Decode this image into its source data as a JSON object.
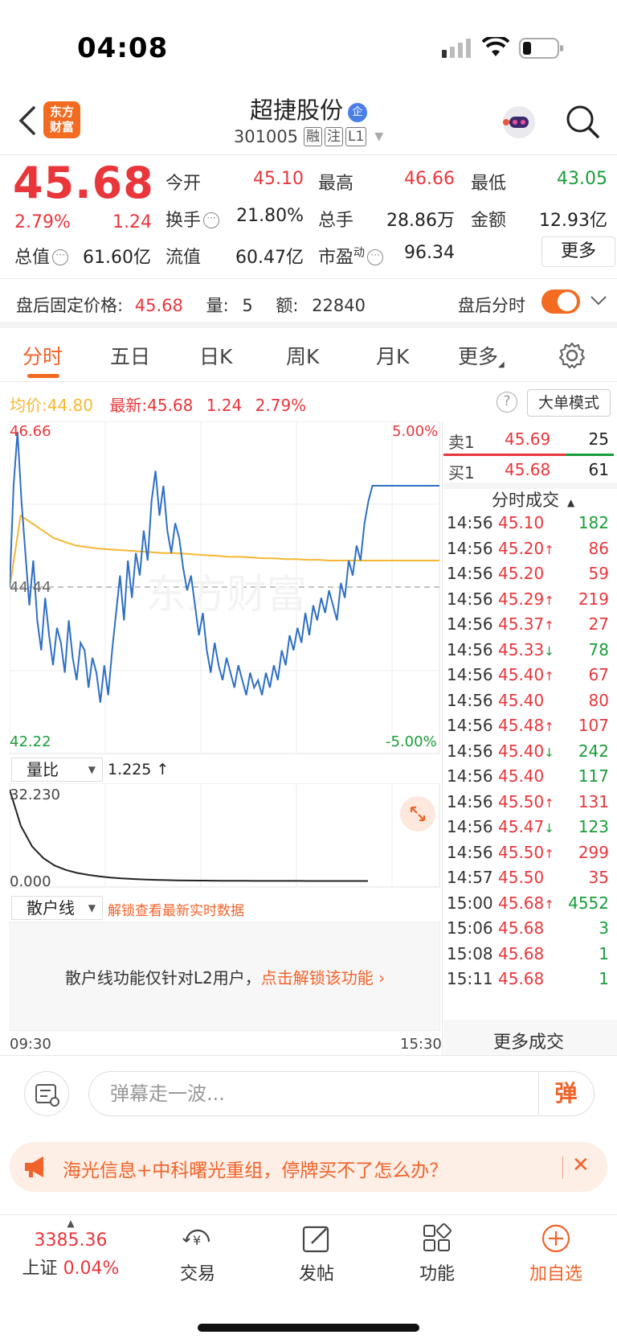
{
  "status_bar": {
    "time": "04:08"
  },
  "header": {
    "logo_text_1": "东方",
    "logo_text_2": "财富",
    "stock_name": "超捷股份",
    "enterprise_badge": "企",
    "stock_code": "301005",
    "tags": [
      "融",
      "注",
      "L1"
    ]
  },
  "quote": {
    "price": "45.68",
    "change_pct": "2.79%",
    "change": "1.24",
    "fields": [
      {
        "label": "今开",
        "value": "45.10",
        "color": "red"
      },
      {
        "label": "最高",
        "value": "46.66",
        "color": "red"
      },
      {
        "label": "最低",
        "value": "43.05",
        "color": "green"
      },
      {
        "label": "换手",
        "value": "21.80%",
        "color": "black"
      },
      {
        "label": "总手",
        "value": "28.86万",
        "color": "black"
      },
      {
        "label": "金额",
        "value": "12.93亿",
        "color": "black"
      },
      {
        "label": "总值",
        "value": "61.60亿",
        "color": "black"
      },
      {
        "label": "流值",
        "value": "60.47亿",
        "color": "black"
      },
      {
        "label": "市盈",
        "value": "96.34",
        "color": "black"
      }
    ],
    "pe_superscript": "动",
    "more_label": "更多"
  },
  "after_hours": {
    "label": "盘后固定价格:",
    "price": "45.68",
    "volume_label": "量:",
    "volume": "5",
    "amount_label": "额:",
    "amount": "22840",
    "toggle_label": "盘后分时",
    "toggle_on": true
  },
  "tabs": [
    "分时",
    "五日",
    "日K",
    "周K",
    "月K",
    "更多"
  ],
  "active_tab": "分时",
  "legend": {
    "avg_label": "均价:",
    "avg_value": "44.80",
    "latest_label": "最新:",
    "latest_value": "45.68",
    "latest_change": "1.24",
    "latest_pct": "2.79%",
    "big_order_label": "大单模式"
  },
  "main_chart": {
    "y_top": "46.66",
    "y_bottom": "42.22",
    "y_mid": "44.44",
    "pct_top": "5.00%",
    "pct_bottom": "-5.00%",
    "watermark": "东方财富",
    "x_start": "09:30",
    "x_end": "15:30"
  },
  "chart_data": {
    "type": "line",
    "title": "",
    "xlabel": "",
    "ylabel": "",
    "ylim": [
      42.22,
      46.66
    ],
    "x_range": [
      "09:30",
      "15:30"
    ],
    "series": [
      {
        "values": [
          44.44,
          45.8,
          46.52,
          45.6,
          44.9,
          44.2,
          44.8,
          44.0,
          43.6,
          44.3,
          43.8,
          43.4,
          43.9,
          43.7,
          43.3,
          44.0,
          43.5,
          43.2,
          43.7,
          43.6,
          43.1,
          43.5,
          43.3,
          42.9,
          43.4,
          43.0,
          43.6,
          44.1,
          44.6,
          44.0,
          44.8,
          44.3,
          44.9,
          44.6,
          45.2,
          44.8,
          45.6,
          46.0,
          45.4,
          45.8,
          45.2,
          44.9,
          45.3,
          45.1,
          44.7,
          44.4,
          44.6,
          44.2,
          43.8,
          44.1,
          43.6,
          43.3,
          43.7,
          43.4,
          43.2,
          43.5,
          43.3,
          43.1,
          43.4,
          43.2,
          43.0,
          43.3,
          43.1,
          43.2,
          43.0,
          43.3,
          43.1,
          43.4,
          43.2,
          43.6,
          43.4,
          43.8,
          43.6,
          43.9,
          43.7,
          44.1,
          43.8,
          44.2,
          44.0,
          44.3,
          44.1,
          44.4,
          44.2,
          44.0,
          44.5,
          44.3,
          44.8,
          44.6,
          45.0,
          44.8,
          45.3,
          45.6,
          45.8,
          45.8,
          45.8,
          45.8,
          45.8,
          45.8,
          45.8,
          45.8,
          45.8,
          45.8,
          45.8,
          45.8,
          45.8,
          45.8,
          45.8,
          45.8,
          45.8,
          45.8
        ]
      },
      {
        "values": [
          44.44,
          45.4,
          45.3,
          45.2,
          45.1,
          45.05,
          45.0,
          44.98,
          44.96,
          44.95,
          44.94,
          44.93,
          44.92,
          44.91,
          44.9,
          44.9,
          44.89,
          44.88,
          44.87,
          44.86,
          44.85,
          44.85,
          44.84,
          44.83,
          44.83,
          44.82,
          44.82,
          44.81,
          44.81,
          44.8,
          44.8,
          44.8,
          44.8,
          44.8,
          44.8,
          44.8,
          44.8,
          44.8,
          44.8,
          44.8
        ]
      }
    ]
  },
  "volume_ratio": {
    "selector_label": "量比",
    "value": "1.225",
    "arrow": "↑",
    "y_top": "32.230",
    "y_bottom": "0.000",
    "chart_data": {
      "type": "line",
      "ylim": [
        0,
        32.23
      ],
      "values": [
        32.23,
        20,
        13,
        9,
        6.5,
        5,
        4,
        3.3,
        2.8,
        2.4,
        2.1,
        1.9,
        1.75,
        1.62,
        1.52,
        1.45,
        1.4,
        1.36,
        1.33,
        1.31,
        1.29,
        1.28,
        1.27,
        1.26,
        1.255,
        1.25,
        1.245,
        1.24,
        1.235,
        1.23,
        1.228,
        1.226,
        1.225
      ]
    }
  },
  "retail_line": {
    "selector_label": "散户线",
    "unlock_hint": "解锁查看最新实时数据",
    "locked_text": "散户线功能仅针对L2用户，",
    "unlock_link": "点击解锁该功能"
  },
  "order_book": {
    "sell": {
      "label": "卖1",
      "price": "45.69",
      "qty": "25"
    },
    "buy": {
      "label": "买1",
      "price": "45.68",
      "qty": "61"
    }
  },
  "trades": {
    "title": "分时成交",
    "rows": [
      {
        "time": "14:56",
        "price": "45.10",
        "arrow": "",
        "qty": "182",
        "qty_color": "green"
      },
      {
        "time": "14:56",
        "price": "45.20",
        "arrow": "↑",
        "qty": "86",
        "qty_color": "red"
      },
      {
        "time": "14:56",
        "price": "45.20",
        "arrow": "",
        "qty": "59",
        "qty_color": "red"
      },
      {
        "time": "14:56",
        "price": "45.29",
        "arrow": "↑",
        "qty": "219",
        "qty_color": "red"
      },
      {
        "time": "14:56",
        "price": "45.37",
        "arrow": "↑",
        "qty": "27",
        "qty_color": "red"
      },
      {
        "time": "14:56",
        "price": "45.33",
        "arrow": "↓",
        "qty": "78",
        "qty_color": "green"
      },
      {
        "time": "14:56",
        "price": "45.40",
        "arrow": "↑",
        "qty": "67",
        "qty_color": "red"
      },
      {
        "time": "14:56",
        "price": "45.40",
        "arrow": "",
        "qty": "80",
        "qty_color": "red"
      },
      {
        "time": "14:56",
        "price": "45.48",
        "arrow": "↑",
        "qty": "107",
        "qty_color": "red"
      },
      {
        "time": "14:56",
        "price": "45.40",
        "arrow": "↓",
        "qty": "242",
        "qty_color": "green"
      },
      {
        "time": "14:56",
        "price": "45.40",
        "arrow": "",
        "qty": "117",
        "qty_color": "green"
      },
      {
        "time": "14:56",
        "price": "45.50",
        "arrow": "↑",
        "qty": "131",
        "qty_color": "red"
      },
      {
        "time": "14:56",
        "price": "45.47",
        "arrow": "↓",
        "qty": "123",
        "qty_color": "green"
      },
      {
        "time": "14:56",
        "price": "45.50",
        "arrow": "↑",
        "qty": "299",
        "qty_color": "red"
      },
      {
        "time": "14:57",
        "price": "45.50",
        "arrow": "",
        "qty": "35",
        "qty_color": "red"
      },
      {
        "time": "15:00",
        "price": "45.68",
        "arrow": "↑",
        "qty": "4552",
        "qty_color": "green"
      },
      {
        "time": "15:06",
        "price": "45.68",
        "arrow": "",
        "qty": "3",
        "qty_color": "green"
      },
      {
        "time": "15:08",
        "price": "45.68",
        "arrow": "",
        "qty": "1",
        "qty_color": "green"
      },
      {
        "time": "15:11",
        "price": "45.68",
        "arrow": "",
        "qty": "1",
        "qty_color": "green"
      }
    ],
    "more_label": "更多成交"
  },
  "comment": {
    "placeholder": "弹幕走一波...",
    "danmu_btn": "弹"
  },
  "news": {
    "text": "海光信息+中科曙光重组，停牌买不了怎么办？",
    "close": "✕"
  },
  "bottom_nav": {
    "index_value": "3385.36",
    "index_name": "上证",
    "index_pct": "0.04%",
    "items": [
      {
        "label": "交易"
      },
      {
        "label": "发帖"
      },
      {
        "label": "功能"
      },
      {
        "label": "加自选"
      }
    ]
  },
  "colors": {
    "up": "#e8363b",
    "down": "#1a9d3a",
    "accent": "#f26b21",
    "price_line": "#2f6fc4",
    "avg_line": "#f5b731"
  }
}
